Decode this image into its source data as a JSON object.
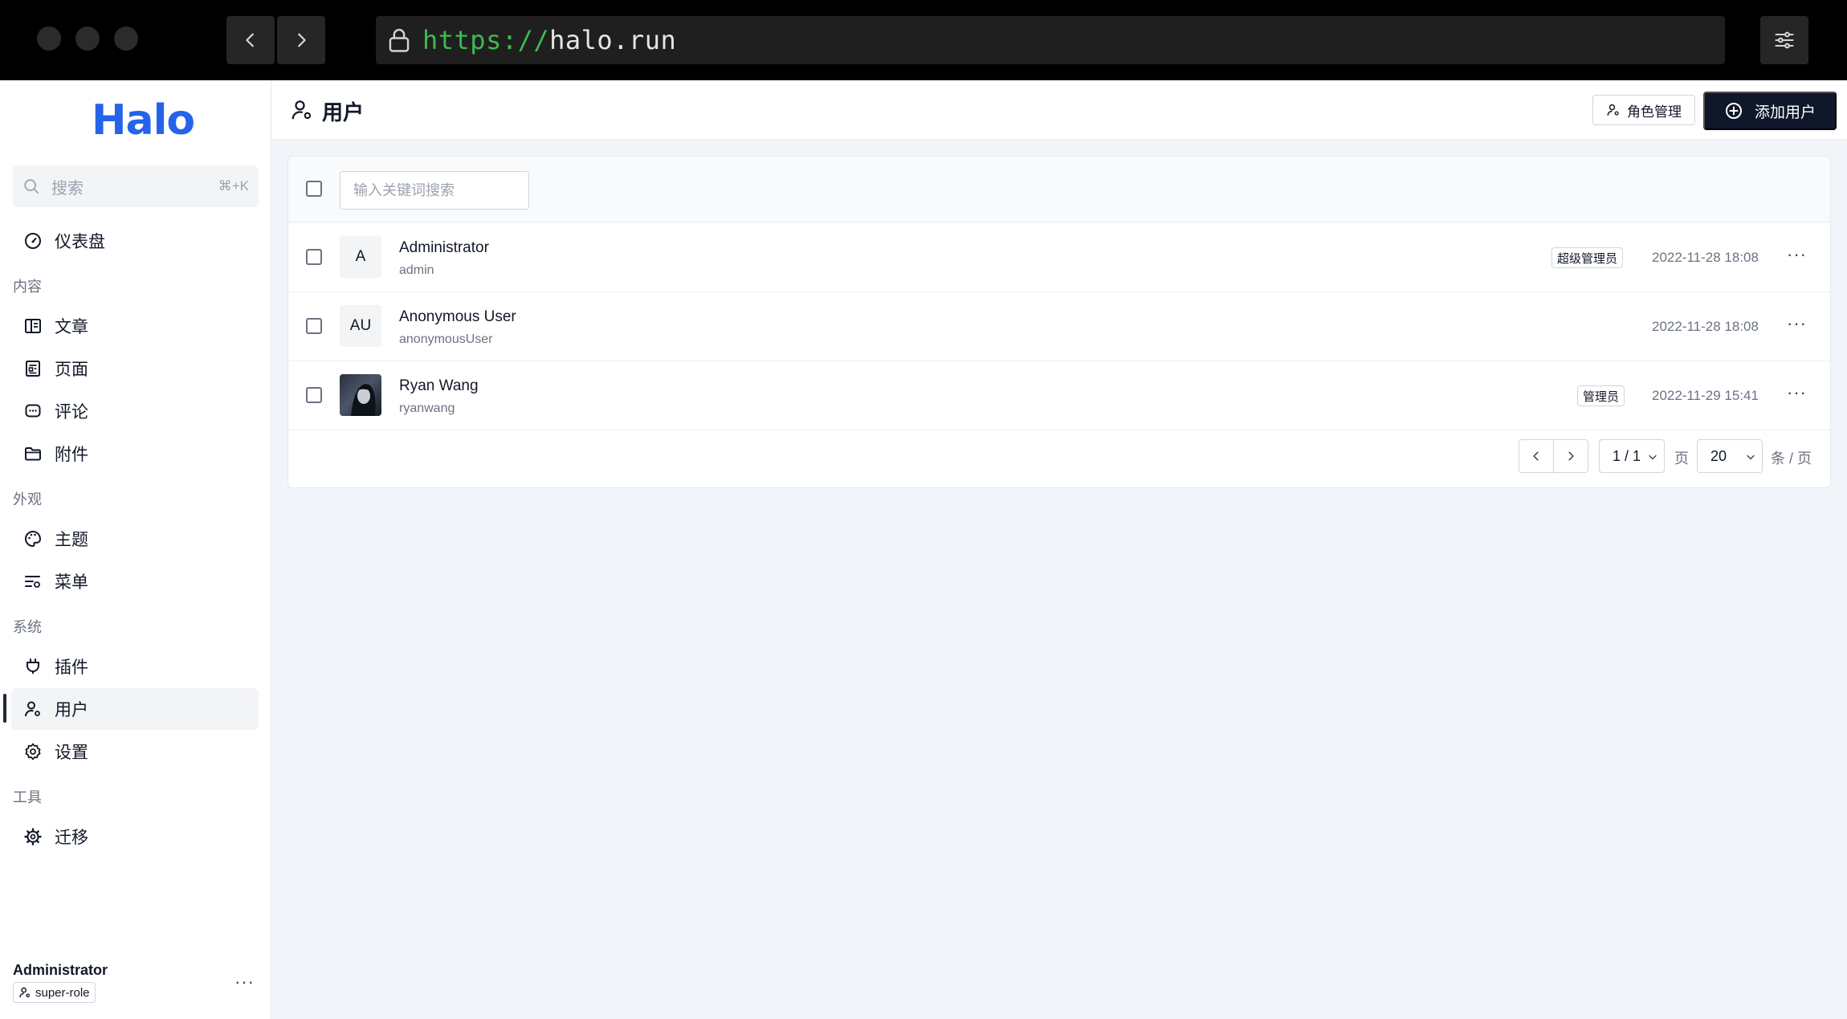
{
  "browser": {
    "url_scheme": "https://",
    "url_host": "halo.run"
  },
  "sidebar": {
    "logo": "Halo",
    "search_placeholder": "搜索",
    "search_shortcut": "⌘+K",
    "groups": {
      "content": "内容",
      "appearance": "外观",
      "system": "系统",
      "tools": "工具"
    },
    "items": {
      "dashboard": "仪表盘",
      "posts": "文章",
      "pages": "页面",
      "comments": "评论",
      "attachments": "附件",
      "themes": "主题",
      "menus": "菜单",
      "plugins": "插件",
      "users": "用户",
      "settings": "设置",
      "migration": "迁移"
    },
    "active_item": "users",
    "profile": {
      "name": "Administrator",
      "role": "super-role"
    }
  },
  "header": {
    "title": "用户",
    "role_button": "角色管理",
    "add_button": "添加用户"
  },
  "list": {
    "search_placeholder": "输入关键词搜索",
    "users": [
      {
        "initials": "A",
        "name": "Administrator",
        "username": "admin",
        "badge": "超级管理员",
        "created": "2022-11-28 18:08"
      },
      {
        "initials": "AU",
        "name": "Anonymous User",
        "username": "anonymousUser",
        "badge": "",
        "created": "2022-11-28 18:08"
      },
      {
        "initials": "",
        "name": "Ryan Wang",
        "username": "ryanwang",
        "badge": "管理员",
        "created": "2022-11-29 15:41"
      }
    ]
  },
  "pagination": {
    "page": "1 / 1",
    "page_unit": "页",
    "size": "20",
    "size_unit": "条 / 页"
  },
  "colors": {
    "brand": "#2563eb",
    "primary_button": "#0f172a",
    "url_scheme": "#3fb950"
  }
}
